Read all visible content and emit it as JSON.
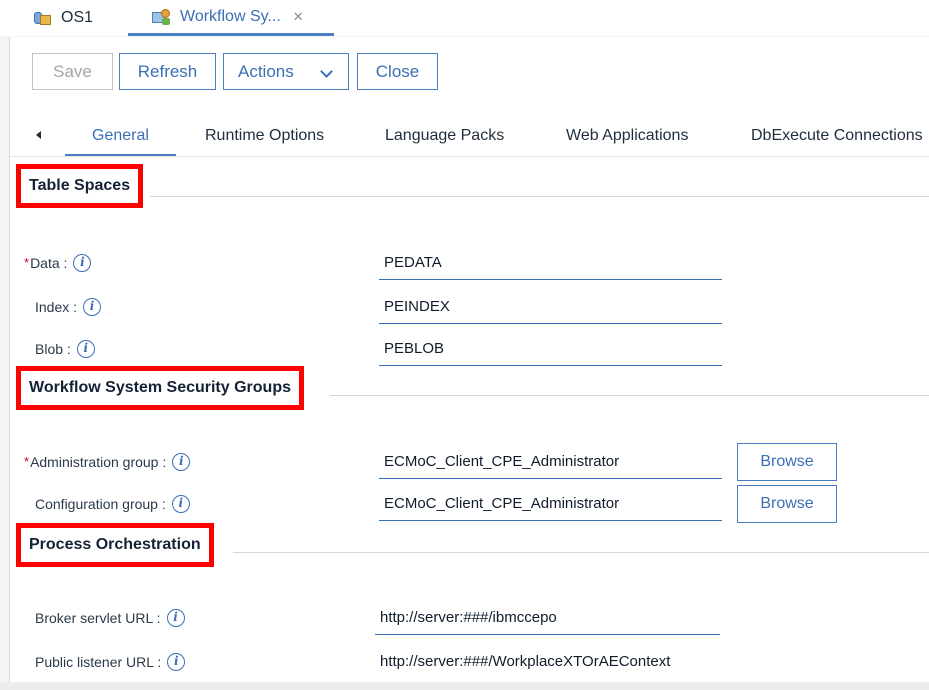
{
  "doc_tabs": [
    {
      "label": "OS1"
    },
    {
      "label": "Workflow Sy...",
      "close": "✕"
    }
  ],
  "toolbar": {
    "save": "Save",
    "refresh": "Refresh",
    "actions": "Actions",
    "close": "Close"
  },
  "section_tabs": [
    "General",
    "Runtime Options",
    "Language Packs",
    "Web Applications",
    "DbExecute Connections"
  ],
  "sections": {
    "table_spaces": {
      "title": "Table Spaces",
      "rows": [
        {
          "label": "Data :",
          "required": "*",
          "value": "PEDATA"
        },
        {
          "label": "Index :",
          "value": "PEINDEX"
        },
        {
          "label": "Blob :",
          "value": "PEBLOB"
        }
      ]
    },
    "security_groups": {
      "title": "Workflow System Security Groups",
      "rows": [
        {
          "label": "Administration group :",
          "required": "*",
          "value": "ECMoC_Client_CPE_Administrator",
          "button": "Browse"
        },
        {
          "label": "Configuration group :",
          "value": "ECMoC_Client_CPE_Administrator",
          "button": "Browse"
        }
      ]
    },
    "process_orchestration": {
      "title": "Process Orchestration",
      "rows": [
        {
          "label": "Broker servlet URL :",
          "value": "http://server:###/ibmccepo"
        },
        {
          "label": "Public listener URL :",
          "value": "http://server:###/WorkplaceXTOrAEContext"
        }
      ]
    }
  },
  "info_glyph": "i",
  "colors": {
    "accent": "#3a6fb5",
    "highlight_box": "#ff0000",
    "required": "#d0021b"
  }
}
